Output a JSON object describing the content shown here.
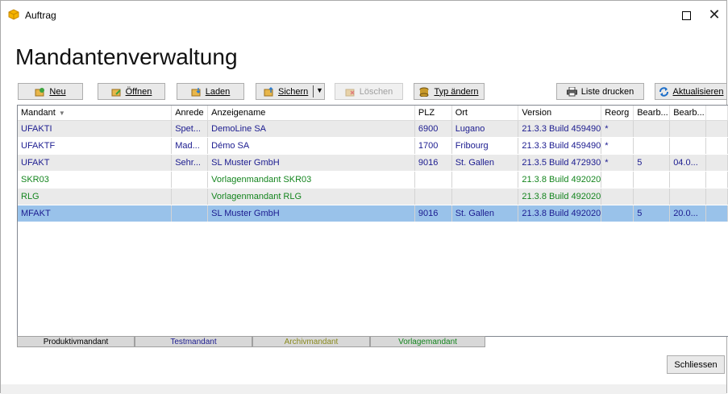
{
  "window": {
    "title": "Auftrag"
  },
  "heading": "Mandantenverwaltung",
  "toolbar": {
    "neu": "Neu",
    "oeffnen": "Öffnen",
    "laden": "Laden",
    "sichern": "Sichern",
    "loeschen": "Löschen",
    "typ_aendern": "Typ ändern",
    "liste_drucken": "Liste drucken",
    "aktualisieren": "Aktualisieren"
  },
  "grid": {
    "columns": [
      "Mandant",
      "Anrede",
      "Anzeigename",
      "PLZ",
      "Ort",
      "Version",
      "Reorg",
      "Bearb...",
      "Bearb..."
    ],
    "rows": [
      {
        "type": "test",
        "cells": [
          "UFAKTI",
          "Spet...",
          "DemoLine SA",
          "6900",
          "Lugano",
          "21.3.3 Build 459490",
          "*",
          "",
          ""
        ]
      },
      {
        "type": "test",
        "cells": [
          "UFAKTF",
          "Mad...",
          "Démo SA",
          "1700",
          "Fribourg",
          "21.3.3 Build 459490",
          "*",
          "",
          ""
        ]
      },
      {
        "type": "test",
        "cells": [
          "UFAKT",
          "Sehr...",
          "SL Muster GmbH",
          "9016",
          "St. Gallen",
          "21.3.5 Build 472930",
          "*",
          "5",
          "04.0..."
        ]
      },
      {
        "type": "vorlage",
        "cells": [
          "SKR03",
          "",
          "Vorlagenmandant SKR03",
          "",
          "",
          "21.3.8 Build 492020",
          "",
          "",
          ""
        ]
      },
      {
        "type": "vorlage",
        "cells": [
          "RLG",
          "",
          "Vorlagenmandant RLG",
          "",
          "",
          "21.3.8 Build 492020",
          "",
          "",
          ""
        ]
      },
      {
        "type": "test",
        "cells": [
          "MFAKT",
          "",
          "SL Muster GmbH",
          "9016",
          "St. Gallen",
          "21.3.8 Build 492020",
          "",
          "5",
          "20.0..."
        ]
      }
    ]
  },
  "legend": {
    "produktiv": "Produktivmandant",
    "test": "Testmandant",
    "archiv": "Archivmandant",
    "vorlage": "Vorlagemandant"
  },
  "colors": {
    "test_text": "#1b1b8f",
    "vorlage_text": "#14851e",
    "archiv_text": "#8a8a1e",
    "selection": "#99c2ea"
  },
  "footer": {
    "schliessen": "Schliessen"
  }
}
